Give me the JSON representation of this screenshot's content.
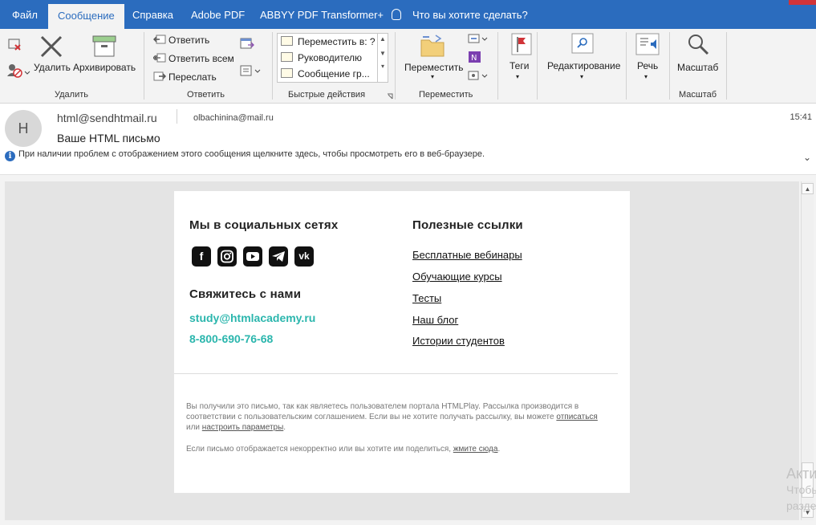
{
  "tabs": [
    "Файл",
    "Сообщение",
    "Справка",
    "Adobe PDF",
    "ABBYY PDF Transformer+",
    "Что вы хотите сделать?"
  ],
  "ribbon": {
    "delete_group": {
      "label": "Удалить",
      "delete_btn": "Удалить",
      "archive_btn": "Архивировать"
    },
    "reply_group": {
      "label": "Ответить",
      "reply": "Ответить",
      "reply_all": "Ответить всем",
      "forward": "Переслать"
    },
    "quick_group": {
      "label": "Быстрые действия",
      "items": [
        "Переместить в: ?",
        "Руководителю",
        "Сообщение гр..."
      ]
    },
    "move_group": {
      "label": "Переместить",
      "move_btn": "Переместить"
    },
    "tags": "Теги",
    "editing": "Редактирование",
    "speech": "Речь",
    "zoom_group": {
      "label": "Масштаб",
      "zoom_btn": "Масштаб"
    }
  },
  "header": {
    "avatar": "H",
    "from": "html@sendhtmail.ru",
    "to": "olbachinina@mail.ru",
    "time": "15:41",
    "subject": "Ваше HTML письмо",
    "info": "При наличии проблем с отображением этого сообщения щелкните здесь, чтобы просмотреть его в веб-браузере."
  },
  "email": {
    "social_title": "Мы в социальных сетях",
    "social_icons": [
      "facebook-icon",
      "instagram-icon",
      "youtube-icon",
      "telegram-icon",
      "vk-icon"
    ],
    "contact_title": "Свяжитесь с нами",
    "email": "study@htmlacademy.ru",
    "phone": "8-800-690-76-68",
    "links_title": "Полезные ссылки",
    "links": [
      "Бесплатные вебинары",
      "Обучающие курсы",
      "Тесты",
      "Наш блог",
      "Истории студентов"
    ],
    "footer1_text": "Вы получили это письмо, так как являетесь пользователем портала HTMLPlay. Рассылка производится в соответствии с пользовательским соглашением. Если вы не хотите получать рассылку, вы можете",
    "unsubscribe": "отписаться",
    "or": "или",
    "settings": "настроить параметры",
    "footer2_text": "Если письмо отображается некорректно или вы хотите им поделиться,",
    "click_here": "жмите сюда"
  },
  "watermark": {
    "line1": "Акти",
    "line2": "Чтобы",
    "line3": "разде"
  },
  "colors": {
    "accent": "#2b6cbe",
    "link_teal": "#2bb6ad"
  }
}
